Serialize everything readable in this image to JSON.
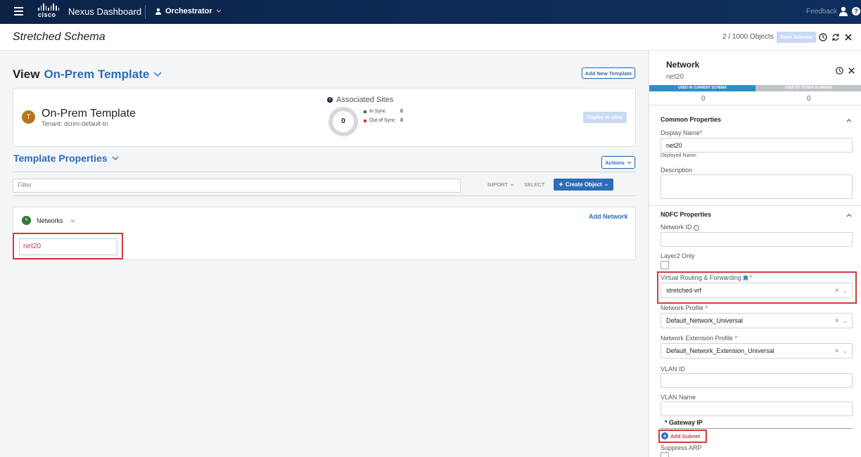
{
  "topbar": {
    "logo_text": "cisco",
    "app_name": "Nexus Dashboard",
    "service": "Orchestrator",
    "feedback": "Feedback",
    "help": "?"
  },
  "header": {
    "title": "Stretched Schema",
    "object_count": "2 / 1000 Objects",
    "save_label": "Save Schema"
  },
  "view": {
    "prefix": "View",
    "template_name": "On-Prem Template",
    "add_template_label": "Add New Template"
  },
  "template_card": {
    "avatar_letter": "T",
    "name": "On-Prem Template",
    "tenant": "Tenant: dcnm-default-tn",
    "associated_icon_count": "0",
    "associated_title": "Associated Sites",
    "donut_value": "0",
    "in_sync_label": "In Sync",
    "in_sync_value": "0",
    "out_of_sync_label": "Out of Sync",
    "out_of_sync_value": "0",
    "deploy_label": "Deploy to sites",
    "in_sync_color": "#2e7d32",
    "out_of_sync_color": "#d23b3b"
  },
  "template_properties": {
    "title": "Template Properties",
    "actions_label": "Actions",
    "filter_placeholder": "Filter",
    "import_label": "IMPORT",
    "select_label": "SELECT",
    "create_label": "Create Object"
  },
  "networks": {
    "avatar_letter": "N",
    "label": "Networks",
    "add_label": "Add Network",
    "items": [
      "net20"
    ]
  },
  "panel": {
    "title": "Network",
    "subtitle": "net20",
    "tabs": [
      {
        "label": "USED IN CURRENT SCHEMA",
        "count": "0"
      },
      {
        "label": "USED BY OTHER SCHEMAS",
        "count": "0"
      }
    ],
    "common": {
      "title": "Common Properties",
      "display_name_label": "Display Name",
      "display_name_value": "net20",
      "deployed_name_label": "Deployed Name:",
      "description_label": "Description"
    },
    "ndfc": {
      "title": "NDFC Properties",
      "network_id_label": "Network ID",
      "layer2_label": "Layer2 Only",
      "vrf_label": "Virtual Routing & Forwarding",
      "vrf_value": "stretched-vrf",
      "network_profile_label": "Network Profile",
      "network_profile_value": "Default_Network_Universal",
      "ext_profile_label": "Network Extension Profile",
      "ext_profile_value": "Default_Network_Extension_Universal",
      "vlan_id_label": "VLAN ID",
      "vlan_name_label": "VLAN Name",
      "gateway_label": "* Gateway IP",
      "add_subnet_label": "Add Subnet",
      "suppress_arp_label": "Suppress ARP"
    }
  }
}
